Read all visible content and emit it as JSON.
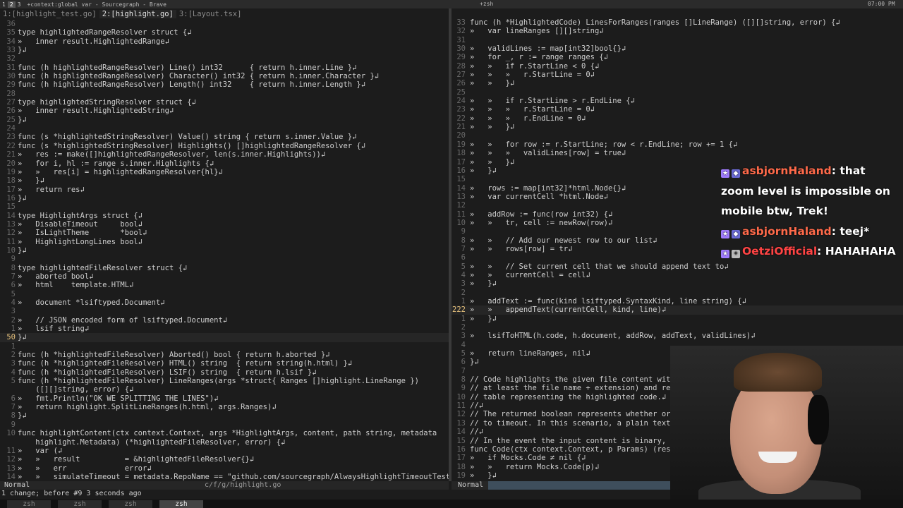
{
  "topbar": {
    "workspaces": [
      "1",
      "2",
      "3"
    ],
    "active_workspace": 1,
    "left_title": "+context:global var - Sourcegraph - Brave",
    "right_title": "+zsh",
    "clock": "07:00 PM"
  },
  "left": {
    "tabs": [
      {
        "label": "1:[highlight_test.go]",
        "active": false
      },
      {
        "label": "2:[highlight.go]",
        "active": true
      },
      {
        "label": "3:[Layout.tsx]",
        "active": false
      }
    ],
    "lines": [
      {
        "n": "36",
        "t": ""
      },
      {
        "n": "35",
        "t": "type highlightedRangeResolver struct {↲"
      },
      {
        "n": "34",
        "t": "»   inner result.HighlightedRange↲"
      },
      {
        "n": "33",
        "t": "}↲"
      },
      {
        "n": "32",
        "t": ""
      },
      {
        "n": "31",
        "t": "func (h highlightedRangeResolver) Line() int32      { return h.inner.Line }↲"
      },
      {
        "n": "30",
        "t": "func (h highlightedRangeResolver) Character() int32 { return h.inner.Character }↲"
      },
      {
        "n": "29",
        "t": "func (h highlightedRangeResolver) Length() int32    { return h.inner.Length }↲"
      },
      {
        "n": "28",
        "t": ""
      },
      {
        "n": "27",
        "t": "type highlightedStringResolver struct {↲"
      },
      {
        "n": "26",
        "t": "»   inner result.HighlightedString↲"
      },
      {
        "n": "25",
        "t": "}↲"
      },
      {
        "n": "24",
        "t": ""
      },
      {
        "n": "23",
        "t": "func (s *highlightedStringResolver) Value() string { return s.inner.Value }↲"
      },
      {
        "n": "22",
        "t": "func (s *highlightedStringResolver) Highlights() []highlightedRangeResolver {↲"
      },
      {
        "n": "21",
        "t": "»   res := make([]highlightedRangeResolver, len(s.inner.Highlights))↲"
      },
      {
        "n": "20",
        "t": "»   for i, hl := range s.inner.Highlights {↲"
      },
      {
        "n": "19",
        "t": "»   »   res[i] = highlightedRangeResolver{hl}↲"
      },
      {
        "n": "18",
        "t": "»   }↲"
      },
      {
        "n": "17",
        "t": "»   return res↲"
      },
      {
        "n": "16",
        "t": "}↲"
      },
      {
        "n": "15",
        "t": ""
      },
      {
        "n": "14",
        "t": "type HighlightArgs struct {↲"
      },
      {
        "n": "13",
        "t": "»   DisableTimeout     bool↲"
      },
      {
        "n": "12",
        "t": "»   IsLightTheme       *bool↲"
      },
      {
        "n": "11",
        "t": "»   HighlightLongLines bool↲"
      },
      {
        "n": "10",
        "t": "}↲"
      },
      {
        "n": "9",
        "t": ""
      },
      {
        "n": "8",
        "t": "type highlightedFileResolver struct {↲"
      },
      {
        "n": "7",
        "t": "»   aborted bool↲"
      },
      {
        "n": "6",
        "t": "»   html    template.HTML↲"
      },
      {
        "n": "5",
        "t": ""
      },
      {
        "n": "4",
        "t": "»   document *lsiftyped.Document↲"
      },
      {
        "n": "3",
        "t": ""
      },
      {
        "n": "2",
        "t": "»   // JSON encoded form of lsiftyped.Document↲"
      },
      {
        "n": "1",
        "t": "»   lsif string↲"
      },
      {
        "n": "50",
        "t": "}↲",
        "current": true
      },
      {
        "n": "1",
        "t": ""
      },
      {
        "n": "2",
        "t": "func (h *highlightedFileResolver) Aborted() bool { return h.aborted }↲"
      },
      {
        "n": "3",
        "t": "func (h *highlightedFileResolver) HTML() string  { return string(h.html) }↲"
      },
      {
        "n": "4",
        "t": "func (h *highlightedFileResolver) LSIF() string  { return h.lsif }↲"
      },
      {
        "n": "5",
        "t": "func (h *highlightedFileResolver) LineRanges(args *struct{ Ranges []highlight.LineRange })"
      },
      {
        "n": "",
        "t": "    ([][]string, error) {↲"
      },
      {
        "n": "6",
        "t": "»   fmt.Println(\"OK WE SPLITTING THE LINES\")↲"
      },
      {
        "n": "7",
        "t": "»   return highlight.SplitLineRanges(h.html, args.Ranges)↲"
      },
      {
        "n": "8",
        "t": "}↲"
      },
      {
        "n": "9",
        "t": ""
      },
      {
        "n": "10",
        "t": "func highlightContent(ctx context.Context, args *HighlightArgs, content, path string, metadata"
      },
      {
        "n": "",
        "t": "    highlight.Metadata) (*highlightedFileResolver, error) {↲"
      },
      {
        "n": "11",
        "t": "»   var (↲"
      },
      {
        "n": "12",
        "t": "»   »   result          = &highlightedFileResolver{}↲"
      },
      {
        "n": "13",
        "t": "»   »   err             error↲"
      },
      {
        "n": "14",
        "t": "»   »   simulateTimeout = metadata.RepoName == \"github.com/sourcegraph/AlwaysHighlightTimeoutTest\""
      }
    ]
  },
  "right": {
    "lines": [
      {
        "n": "33",
        "t": "func (h *HighlightedCode) LinesForRanges(ranges []LineRange) ([][]string, error) {↲"
      },
      {
        "n": "32",
        "t": "»   var lineRanges [][]string↲"
      },
      {
        "n": "31",
        "t": ""
      },
      {
        "n": "30",
        "t": "»   validLines := map[int32]bool{}↲"
      },
      {
        "n": "29",
        "t": "»   for _, r := range ranges {↲"
      },
      {
        "n": "28",
        "t": "»   »   if r.StartLine < 0 {↲"
      },
      {
        "n": "27",
        "t": "»   »   »   r.StartLine = 0↲"
      },
      {
        "n": "26",
        "t": "»   »   }↲"
      },
      {
        "n": "25",
        "t": ""
      },
      {
        "n": "24",
        "t": "»   »   if r.StartLine > r.EndLine {↲"
      },
      {
        "n": "23",
        "t": "»   »   »   r.StartLine = 0↲"
      },
      {
        "n": "22",
        "t": "»   »   »   r.EndLine = 0↲"
      },
      {
        "n": "21",
        "t": "»   »   }↲"
      },
      {
        "n": "20",
        "t": ""
      },
      {
        "n": "19",
        "t": "»   »   for row := r.StartLine; row < r.EndLine; row += 1 {↲"
      },
      {
        "n": "18",
        "t": "»   »   »   validLines[row] = true↲"
      },
      {
        "n": "17",
        "t": "»   »   }↲"
      },
      {
        "n": "16",
        "t": "»   }↲"
      },
      {
        "n": "15",
        "t": ""
      },
      {
        "n": "14",
        "t": "»   rows := map[int32]*html.Node{}↲"
      },
      {
        "n": "13",
        "t": "»   var currentCell *html.Node↲"
      },
      {
        "n": "12",
        "t": ""
      },
      {
        "n": "11",
        "t": "»   addRow := func(row int32) {↲"
      },
      {
        "n": "10",
        "t": "»   »   tr, cell := newRow(row)↲"
      },
      {
        "n": "9",
        "t": ""
      },
      {
        "n": "8",
        "t": "»   »   // Add our newest row to our list↲"
      },
      {
        "n": "7",
        "t": "»   »   rows[row] = tr↲"
      },
      {
        "n": "6",
        "t": ""
      },
      {
        "n": "5",
        "t": "»   »   // Set current cell that we should append text to↲"
      },
      {
        "n": "4",
        "t": "»   »   currentCell = cell↲"
      },
      {
        "n": "3",
        "t": "»   }↲"
      },
      {
        "n": "2",
        "t": ""
      },
      {
        "n": "1",
        "t": "»   addText := func(kind lsiftyped.SyntaxKind, line string) {↲"
      },
      {
        "n": "222",
        "t": "»   »   appendText(currentCell, kind, line)↲",
        "current": true
      },
      {
        "n": "1",
        "t": "»   }↲"
      },
      {
        "n": "2",
        "t": ""
      },
      {
        "n": "3",
        "t": "»   lsifToHTML(h.code, h.document, addRow, addText, validLines)↲"
      },
      {
        "n": "4",
        "t": ""
      },
      {
        "n": "5",
        "t": "»   return lineRanges, nil↲"
      },
      {
        "n": "6",
        "t": "}↲"
      },
      {
        "n": "7",
        "t": ""
      },
      {
        "n": "8",
        "t": "// Code highlights the given file content with the given↲"
      },
      {
        "n": "9",
        "t": "// at least the file name + extension) and returns the pr"
      },
      {
        "n": "10",
        "t": "// table representing the highlighted code.↲"
      },
      {
        "n": "11",
        "t": "//↲"
      },
      {
        "n": "12",
        "t": "// The returned boolean represents whether or no"
      },
      {
        "n": "13",
        "t": "// to timeout. In this scenario, a plain text ta"
      },
      {
        "n": "14",
        "t": "//↲"
      },
      {
        "n": "15",
        "t": "// In the event the input content is binary, Err"
      },
      {
        "n": "16",
        "t": "func Code(ctx context.Context, p Params) (respons                err error) {↲"
      },
      {
        "n": "17",
        "t": "»   if Mocks.Code ≠ nil {↲"
      },
      {
        "n": "18",
        "t": "»   »   return Mocks.Code(p)↲"
      },
      {
        "n": "19",
        "t": "»   }↲"
      }
    ]
  },
  "status": {
    "left_mode": "Normal",
    "left_file": "c/f/g/highlight.go",
    "right_mode": "Normal",
    "message": "1 change; before #9  3 seconds ago"
  },
  "tmux": {
    "windows": [
      {
        "label": "zsh",
        "active": false
      },
      {
        "label": "zsh",
        "active": false
      },
      {
        "label": "zsh",
        "active": false
      },
      {
        "label": "zsh",
        "active": true
      }
    ]
  },
  "chat": {
    "messages": [
      {
        "user": "asbjornHaland",
        "badges": [
          "star",
          "sub"
        ],
        "text": "that zoom level is impossible on mobile btw, Trek!",
        "color": "#ff6a4a"
      },
      {
        "user": "asbjornHaland",
        "badges": [
          "star",
          "sub"
        ],
        "text": "teej*",
        "color": "#ff6a4a"
      },
      {
        "user": "OetziOfficial",
        "badges": [
          "star",
          "gift"
        ],
        "text": "HAHAHAHA",
        "color": "#ff4444"
      }
    ]
  },
  "colors": {
    "background": "#1c1c1c",
    "statusline": "#262626",
    "statusline_fill": "#3e4e5c",
    "current_line_number": "#e5c07b"
  }
}
